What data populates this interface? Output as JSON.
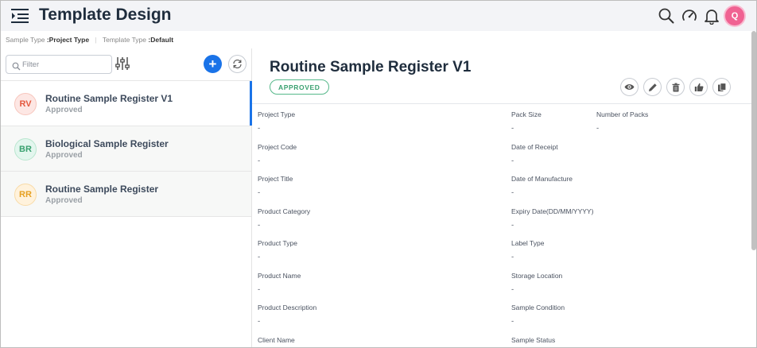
{
  "header": {
    "title": "Template Design",
    "avatar_initial": "Q"
  },
  "subheader": {
    "sample_type_label": "Sample Type",
    "sample_type_value": ":Project Type",
    "separator": "|",
    "template_type_label": "Template Type",
    "template_type_value": ":Default"
  },
  "sidebar": {
    "filter_placeholder": "Filter",
    "add_label": "+",
    "items": [
      {
        "initials": "RV",
        "name": "Routine Sample Register V1",
        "status": "Approved",
        "badge_bg": "#fde7e4",
        "badge_fg": "#e4593f",
        "badge_border": "#f7c6bd"
      },
      {
        "initials": "BR",
        "name": "Biological Sample Register",
        "status": "Approved",
        "badge_bg": "#e3f6ee",
        "badge_fg": "#3aa170",
        "badge_border": "#b9e6cf"
      },
      {
        "initials": "RR",
        "name": "Routine Sample Register",
        "status": "Approved",
        "badge_bg": "#fff2dc",
        "badge_fg": "#e6a020",
        "badge_border": "#f8dba8"
      }
    ]
  },
  "detail": {
    "title": "Routine Sample Register V1",
    "status": "APPROVED",
    "fields": {
      "project_type": {
        "label": "Project Type",
        "value": "-"
      },
      "project_code": {
        "label": "Project Code",
        "value": "-"
      },
      "project_title": {
        "label": "Project Title",
        "value": "-"
      },
      "product_category": {
        "label": "Product Category",
        "value": "-"
      },
      "product_type": {
        "label": "Product Type",
        "value": "-"
      },
      "product_name": {
        "label": "Product Name",
        "value": "-"
      },
      "product_description": {
        "label": "Product Description",
        "value": "-"
      },
      "client_name": {
        "label": "Client Name",
        "value": ""
      },
      "pack_size": {
        "label": "Pack Size",
        "value": "-"
      },
      "number_of_packs": {
        "label": "Number of Packs",
        "value": "-"
      },
      "date_of_receipt": {
        "label": "Date of Receipt",
        "value": "-"
      },
      "date_of_manufacture": {
        "label": "Date of Manufacture",
        "value": "-"
      },
      "expiry_date": {
        "label": "Expiry Date(DD/MM/YYYY)",
        "value": "-"
      },
      "label_type": {
        "label": "Label Type",
        "value": "-"
      },
      "storage_location": {
        "label": "Storage Location",
        "value": "-"
      },
      "sample_condition": {
        "label": "Sample Condition",
        "value": "-"
      },
      "sample_status": {
        "label": "Sample Status",
        "value": ""
      }
    }
  },
  "colors": {
    "accent": "#1a73e8",
    "approved_green": "#3aa170",
    "avatar_pink": "#f06292",
    "title_dark": "#1f2d3d"
  },
  "icons": [
    "menu-icon",
    "search-icon",
    "speedometer-icon",
    "bell-icon",
    "filter-search-icon",
    "tune-icon",
    "plus-icon",
    "refresh-icon",
    "eye-icon",
    "pencil-icon",
    "trash-icon",
    "thumbs-up-icon",
    "copy-icon"
  ]
}
